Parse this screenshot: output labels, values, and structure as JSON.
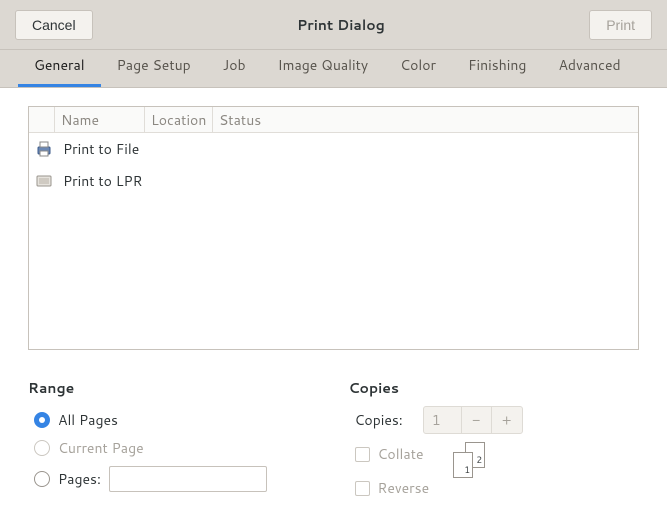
{
  "header": {
    "cancel": "Cancel",
    "title": "Print Dialog",
    "print": "Print"
  },
  "tabs": [
    {
      "id": "general",
      "label": "General",
      "active": true
    },
    {
      "id": "page-setup",
      "label": "Page Setup"
    },
    {
      "id": "job",
      "label": "Job"
    },
    {
      "id": "image-quality",
      "label": "Image Quality"
    },
    {
      "id": "color",
      "label": "Color"
    },
    {
      "id": "finishing",
      "label": "Finishing"
    },
    {
      "id": "advanced",
      "label": "Advanced"
    }
  ],
  "list": {
    "columns": {
      "name": "Name",
      "location": "Location",
      "status": "Status"
    },
    "rows": [
      {
        "id": "print-to-file",
        "name": "Print to File",
        "icon": "printer"
      },
      {
        "id": "print-to-lpr",
        "name": "Print to LPR",
        "icon": "generic"
      }
    ]
  },
  "range": {
    "title": "Range",
    "all": "All Pages",
    "current": "Current Page",
    "pages": "Pages:",
    "selected": "all",
    "pages_value": ""
  },
  "copies": {
    "title": "Copies",
    "label": "Copies:",
    "value": "1",
    "minus": "−",
    "plus": "+",
    "collate": "Collate",
    "reverse": "Reverse",
    "glyph_1": "1",
    "glyph_2": "2"
  }
}
